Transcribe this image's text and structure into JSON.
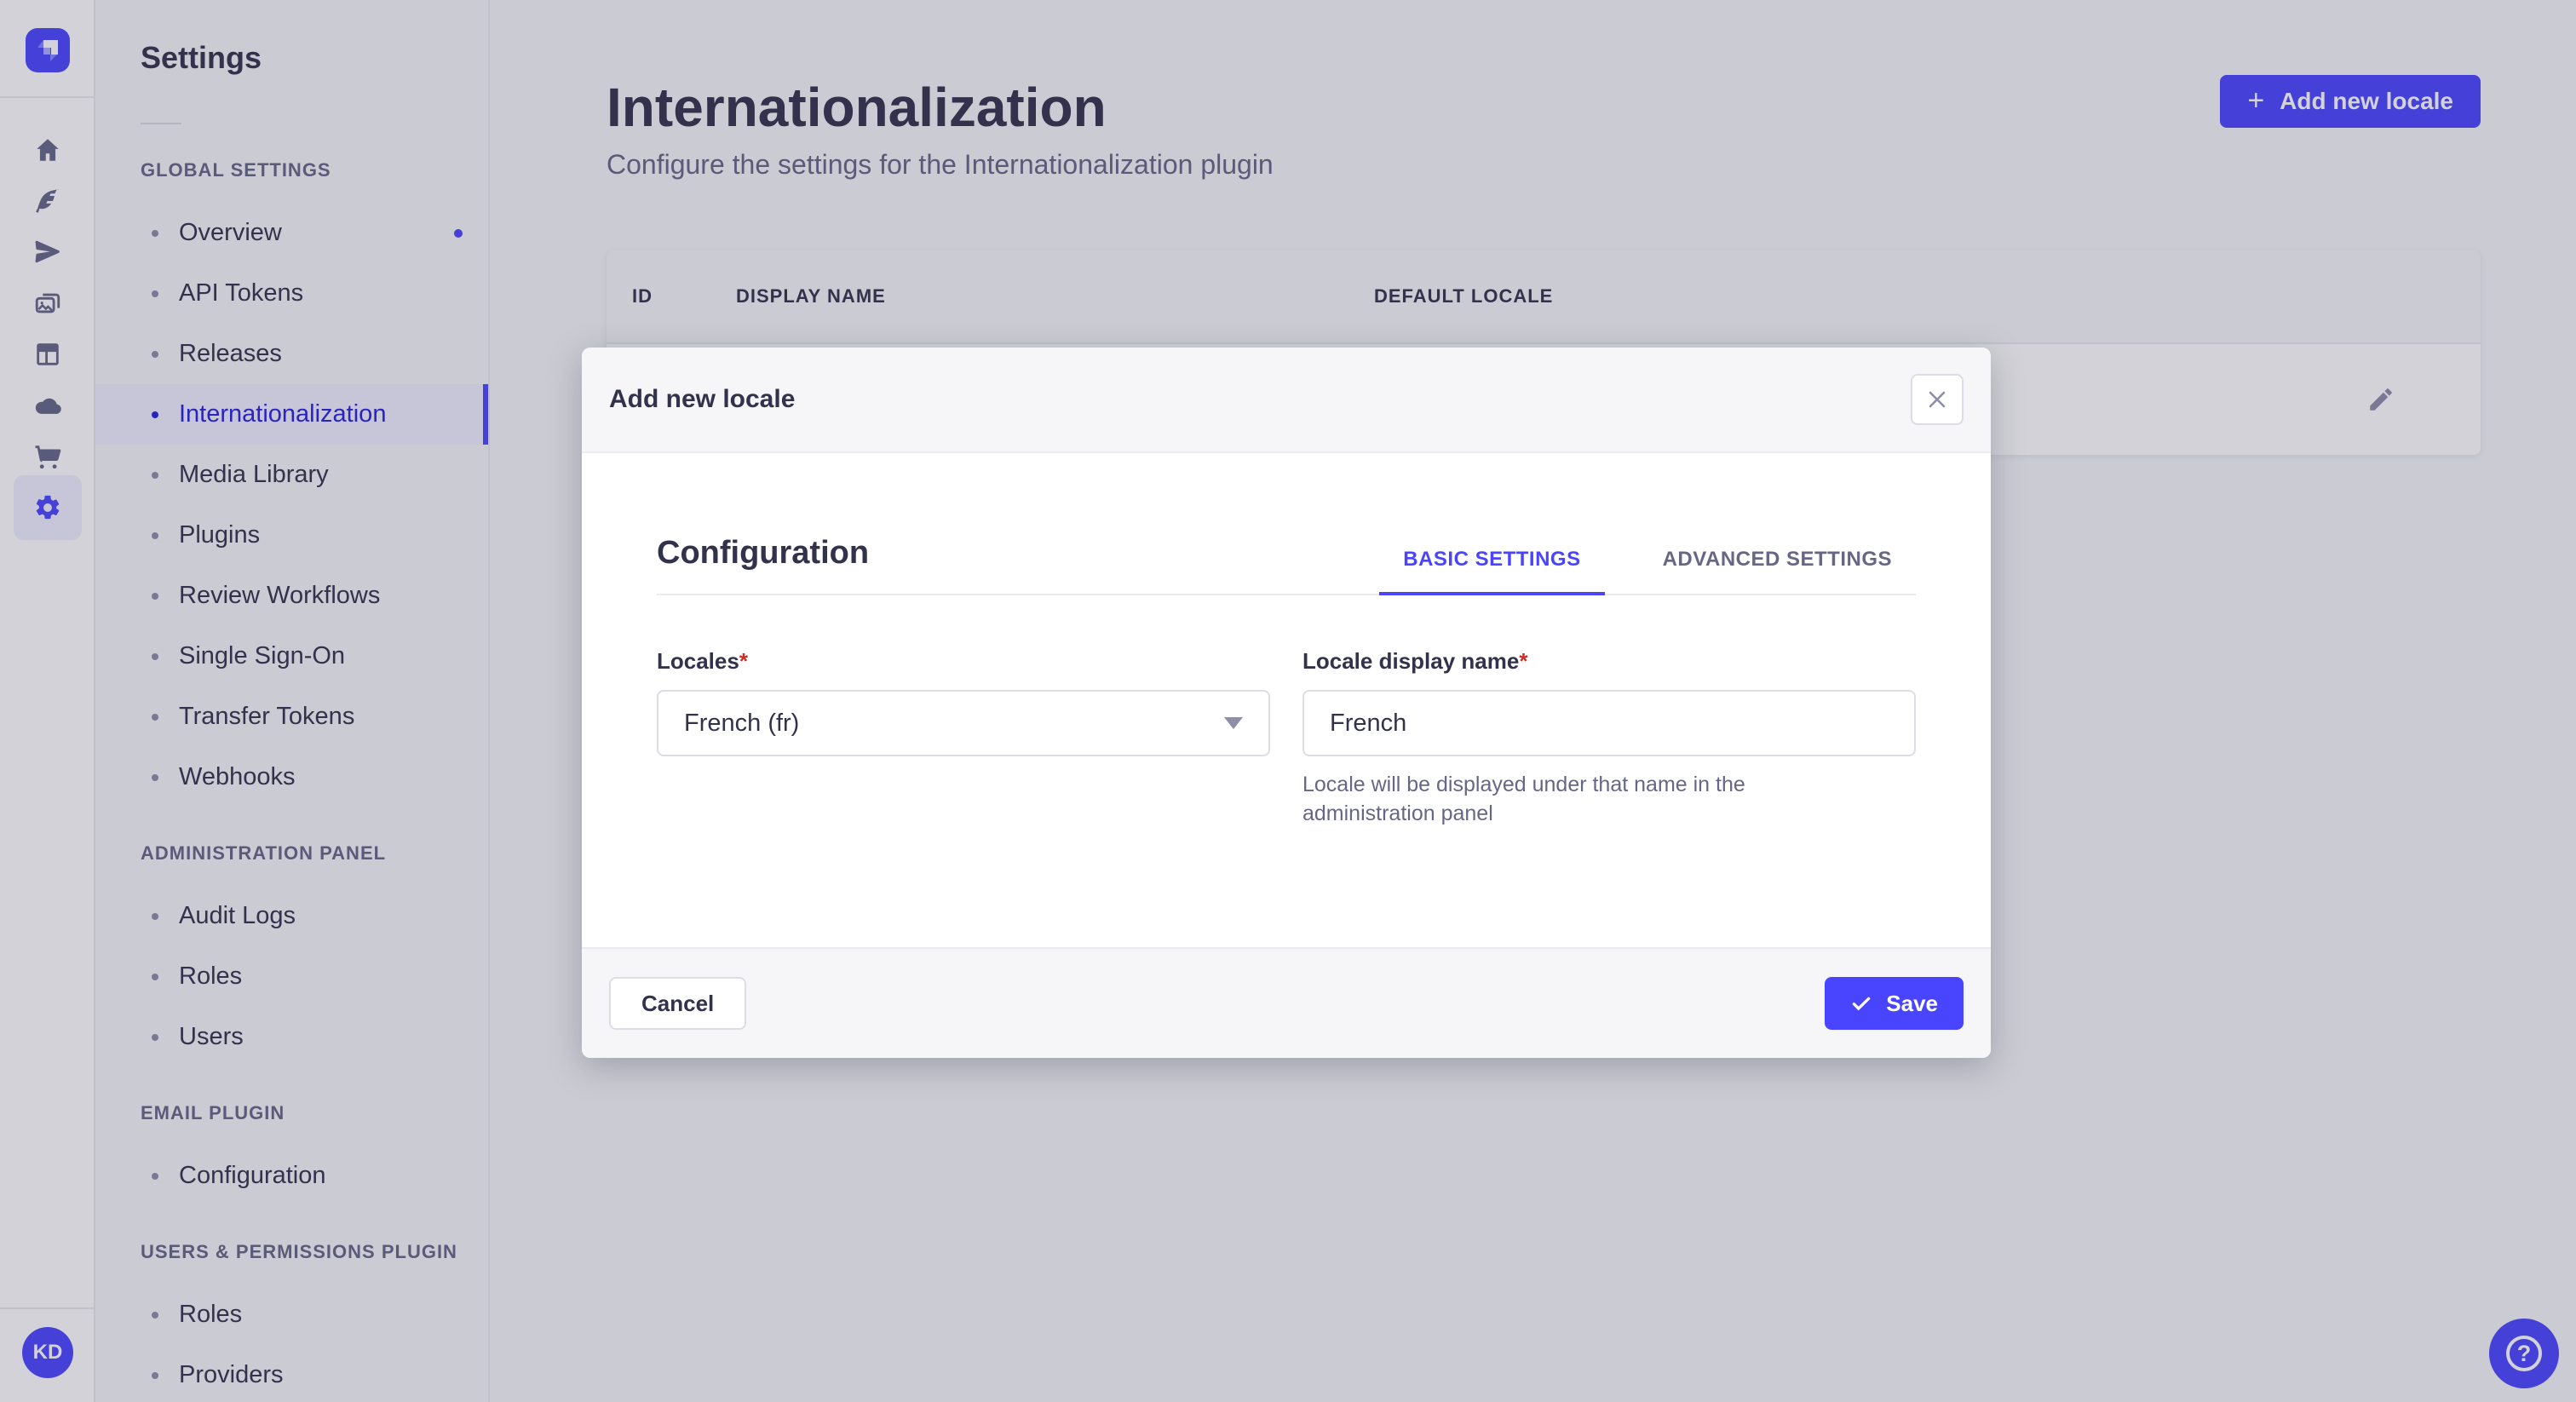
{
  "colors": {
    "accent": "#4945ff",
    "accent_dark": "#271fe0",
    "accent_light_bg": "#f0f0ff",
    "text": "#32324d",
    "text_muted": "#666687",
    "border": "#eaeaef",
    "required": "#d02b20"
  },
  "icons": {
    "plus": "+",
    "question": "?",
    "avatar_initials": "KD"
  },
  "icon_rail": {
    "items": [
      "home",
      "content-feather",
      "releases-plane",
      "media-library-images",
      "layout",
      "cloud",
      "marketplace-cart",
      "settings-gear"
    ],
    "active": "settings-gear"
  },
  "sidebar": {
    "title": "Settings",
    "sections": [
      {
        "label": "GLOBAL SETTINGS",
        "items": [
          {
            "label": "Overview",
            "notification": true
          },
          {
            "label": "API Tokens"
          },
          {
            "label": "Releases"
          },
          {
            "label": "Internationalization",
            "active": true
          },
          {
            "label": "Media Library"
          },
          {
            "label": "Plugins"
          },
          {
            "label": "Review Workflows"
          },
          {
            "label": "Single Sign-On"
          },
          {
            "label": "Transfer Tokens"
          },
          {
            "label": "Webhooks"
          }
        ]
      },
      {
        "label": "ADMINISTRATION PANEL",
        "items": [
          {
            "label": "Audit Logs"
          },
          {
            "label": "Roles"
          },
          {
            "label": "Users"
          }
        ]
      },
      {
        "label": "EMAIL PLUGIN",
        "items": [
          {
            "label": "Configuration"
          }
        ]
      },
      {
        "label": "USERS & PERMISSIONS PLUGIN",
        "items": [
          {
            "label": "Roles"
          },
          {
            "label": "Providers"
          }
        ]
      }
    ]
  },
  "header": {
    "title": "Internationalization",
    "subtitle": "Configure the settings for the Internationalization plugin",
    "add_button": "Add new locale"
  },
  "table": {
    "columns": [
      "ID",
      "DISPLAY NAME",
      "DEFAULT LOCALE"
    ]
  },
  "modal": {
    "title": "Add new locale",
    "section_title": "Configuration",
    "tabs": [
      {
        "label": "BASIC SETTINGS",
        "active": true
      },
      {
        "label": "ADVANCED SETTINGS",
        "active": false
      }
    ],
    "required_mark": "*",
    "fields": {
      "locales": {
        "label": "Locales",
        "value": "French (fr)"
      },
      "display_name": {
        "label": "Locale display name",
        "value": "French",
        "hint": "Locale will be displayed under that name in the administration panel"
      }
    },
    "cancel_label": "Cancel",
    "save_label": "Save"
  }
}
